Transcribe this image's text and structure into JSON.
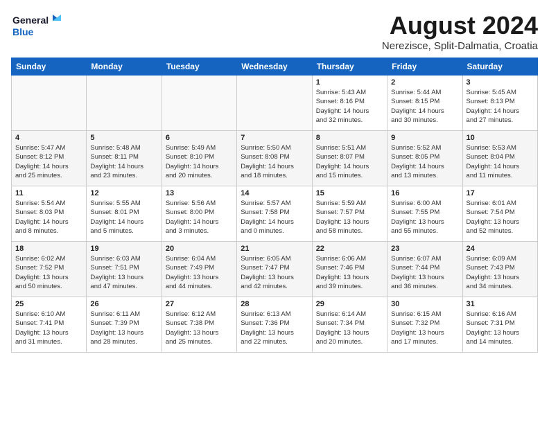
{
  "header": {
    "logo_line1": "General",
    "logo_line2": "Blue",
    "month_title": "August 2024",
    "location": "Nerezisce, Split-Dalmatia, Croatia"
  },
  "weekdays": [
    "Sunday",
    "Monday",
    "Tuesday",
    "Wednesday",
    "Thursday",
    "Friday",
    "Saturday"
  ],
  "weeks": [
    [
      {
        "day": "",
        "info": ""
      },
      {
        "day": "",
        "info": ""
      },
      {
        "day": "",
        "info": ""
      },
      {
        "day": "",
        "info": ""
      },
      {
        "day": "1",
        "info": "Sunrise: 5:43 AM\nSunset: 8:16 PM\nDaylight: 14 hours\nand 32 minutes."
      },
      {
        "day": "2",
        "info": "Sunrise: 5:44 AM\nSunset: 8:15 PM\nDaylight: 14 hours\nand 30 minutes."
      },
      {
        "day": "3",
        "info": "Sunrise: 5:45 AM\nSunset: 8:13 PM\nDaylight: 14 hours\nand 27 minutes."
      }
    ],
    [
      {
        "day": "4",
        "info": "Sunrise: 5:47 AM\nSunset: 8:12 PM\nDaylight: 14 hours\nand 25 minutes."
      },
      {
        "day": "5",
        "info": "Sunrise: 5:48 AM\nSunset: 8:11 PM\nDaylight: 14 hours\nand 23 minutes."
      },
      {
        "day": "6",
        "info": "Sunrise: 5:49 AM\nSunset: 8:10 PM\nDaylight: 14 hours\nand 20 minutes."
      },
      {
        "day": "7",
        "info": "Sunrise: 5:50 AM\nSunset: 8:08 PM\nDaylight: 14 hours\nand 18 minutes."
      },
      {
        "day": "8",
        "info": "Sunrise: 5:51 AM\nSunset: 8:07 PM\nDaylight: 14 hours\nand 15 minutes."
      },
      {
        "day": "9",
        "info": "Sunrise: 5:52 AM\nSunset: 8:05 PM\nDaylight: 14 hours\nand 13 minutes."
      },
      {
        "day": "10",
        "info": "Sunrise: 5:53 AM\nSunset: 8:04 PM\nDaylight: 14 hours\nand 11 minutes."
      }
    ],
    [
      {
        "day": "11",
        "info": "Sunrise: 5:54 AM\nSunset: 8:03 PM\nDaylight: 14 hours\nand 8 minutes."
      },
      {
        "day": "12",
        "info": "Sunrise: 5:55 AM\nSunset: 8:01 PM\nDaylight: 14 hours\nand 5 minutes."
      },
      {
        "day": "13",
        "info": "Sunrise: 5:56 AM\nSunset: 8:00 PM\nDaylight: 14 hours\nand 3 minutes."
      },
      {
        "day": "14",
        "info": "Sunrise: 5:57 AM\nSunset: 7:58 PM\nDaylight: 14 hours\nand 0 minutes."
      },
      {
        "day": "15",
        "info": "Sunrise: 5:59 AM\nSunset: 7:57 PM\nDaylight: 13 hours\nand 58 minutes."
      },
      {
        "day": "16",
        "info": "Sunrise: 6:00 AM\nSunset: 7:55 PM\nDaylight: 13 hours\nand 55 minutes."
      },
      {
        "day": "17",
        "info": "Sunrise: 6:01 AM\nSunset: 7:54 PM\nDaylight: 13 hours\nand 52 minutes."
      }
    ],
    [
      {
        "day": "18",
        "info": "Sunrise: 6:02 AM\nSunset: 7:52 PM\nDaylight: 13 hours\nand 50 minutes."
      },
      {
        "day": "19",
        "info": "Sunrise: 6:03 AM\nSunset: 7:51 PM\nDaylight: 13 hours\nand 47 minutes."
      },
      {
        "day": "20",
        "info": "Sunrise: 6:04 AM\nSunset: 7:49 PM\nDaylight: 13 hours\nand 44 minutes."
      },
      {
        "day": "21",
        "info": "Sunrise: 6:05 AM\nSunset: 7:47 PM\nDaylight: 13 hours\nand 42 minutes."
      },
      {
        "day": "22",
        "info": "Sunrise: 6:06 AM\nSunset: 7:46 PM\nDaylight: 13 hours\nand 39 minutes."
      },
      {
        "day": "23",
        "info": "Sunrise: 6:07 AM\nSunset: 7:44 PM\nDaylight: 13 hours\nand 36 minutes."
      },
      {
        "day": "24",
        "info": "Sunrise: 6:09 AM\nSunset: 7:43 PM\nDaylight: 13 hours\nand 34 minutes."
      }
    ],
    [
      {
        "day": "25",
        "info": "Sunrise: 6:10 AM\nSunset: 7:41 PM\nDaylight: 13 hours\nand 31 minutes."
      },
      {
        "day": "26",
        "info": "Sunrise: 6:11 AM\nSunset: 7:39 PM\nDaylight: 13 hours\nand 28 minutes."
      },
      {
        "day": "27",
        "info": "Sunrise: 6:12 AM\nSunset: 7:38 PM\nDaylight: 13 hours\nand 25 minutes."
      },
      {
        "day": "28",
        "info": "Sunrise: 6:13 AM\nSunset: 7:36 PM\nDaylight: 13 hours\nand 22 minutes."
      },
      {
        "day": "29",
        "info": "Sunrise: 6:14 AM\nSunset: 7:34 PM\nDaylight: 13 hours\nand 20 minutes."
      },
      {
        "day": "30",
        "info": "Sunrise: 6:15 AM\nSunset: 7:32 PM\nDaylight: 13 hours\nand 17 minutes."
      },
      {
        "day": "31",
        "info": "Sunrise: 6:16 AM\nSunset: 7:31 PM\nDaylight: 13 hours\nand 14 minutes."
      }
    ]
  ]
}
